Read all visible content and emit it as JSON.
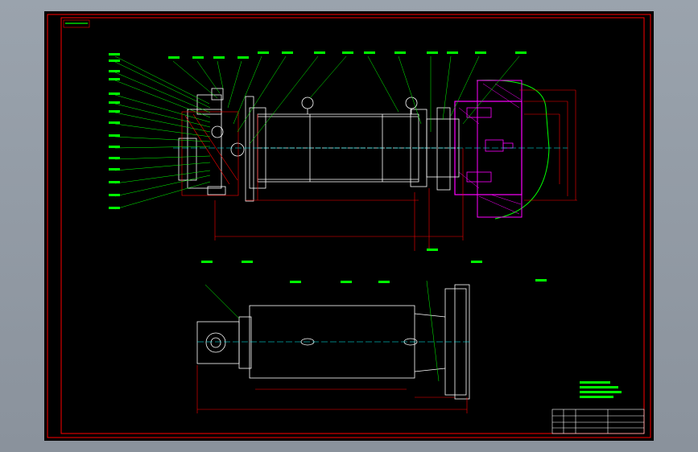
{
  "drawing": {
    "frame_label": "",
    "colors": {
      "background": "#000000",
      "outline": "#ffffff",
      "dimension": "#ff0000",
      "leader": "#00ff00",
      "fixture": "#ff00ff",
      "centerline": "#00ffff",
      "frame": "#ff0000"
    },
    "views": [
      "section-view",
      "top-view"
    ],
    "title_block": {
      "cells": [
        "",
        "",
        "",
        ""
      ]
    },
    "notes": []
  }
}
